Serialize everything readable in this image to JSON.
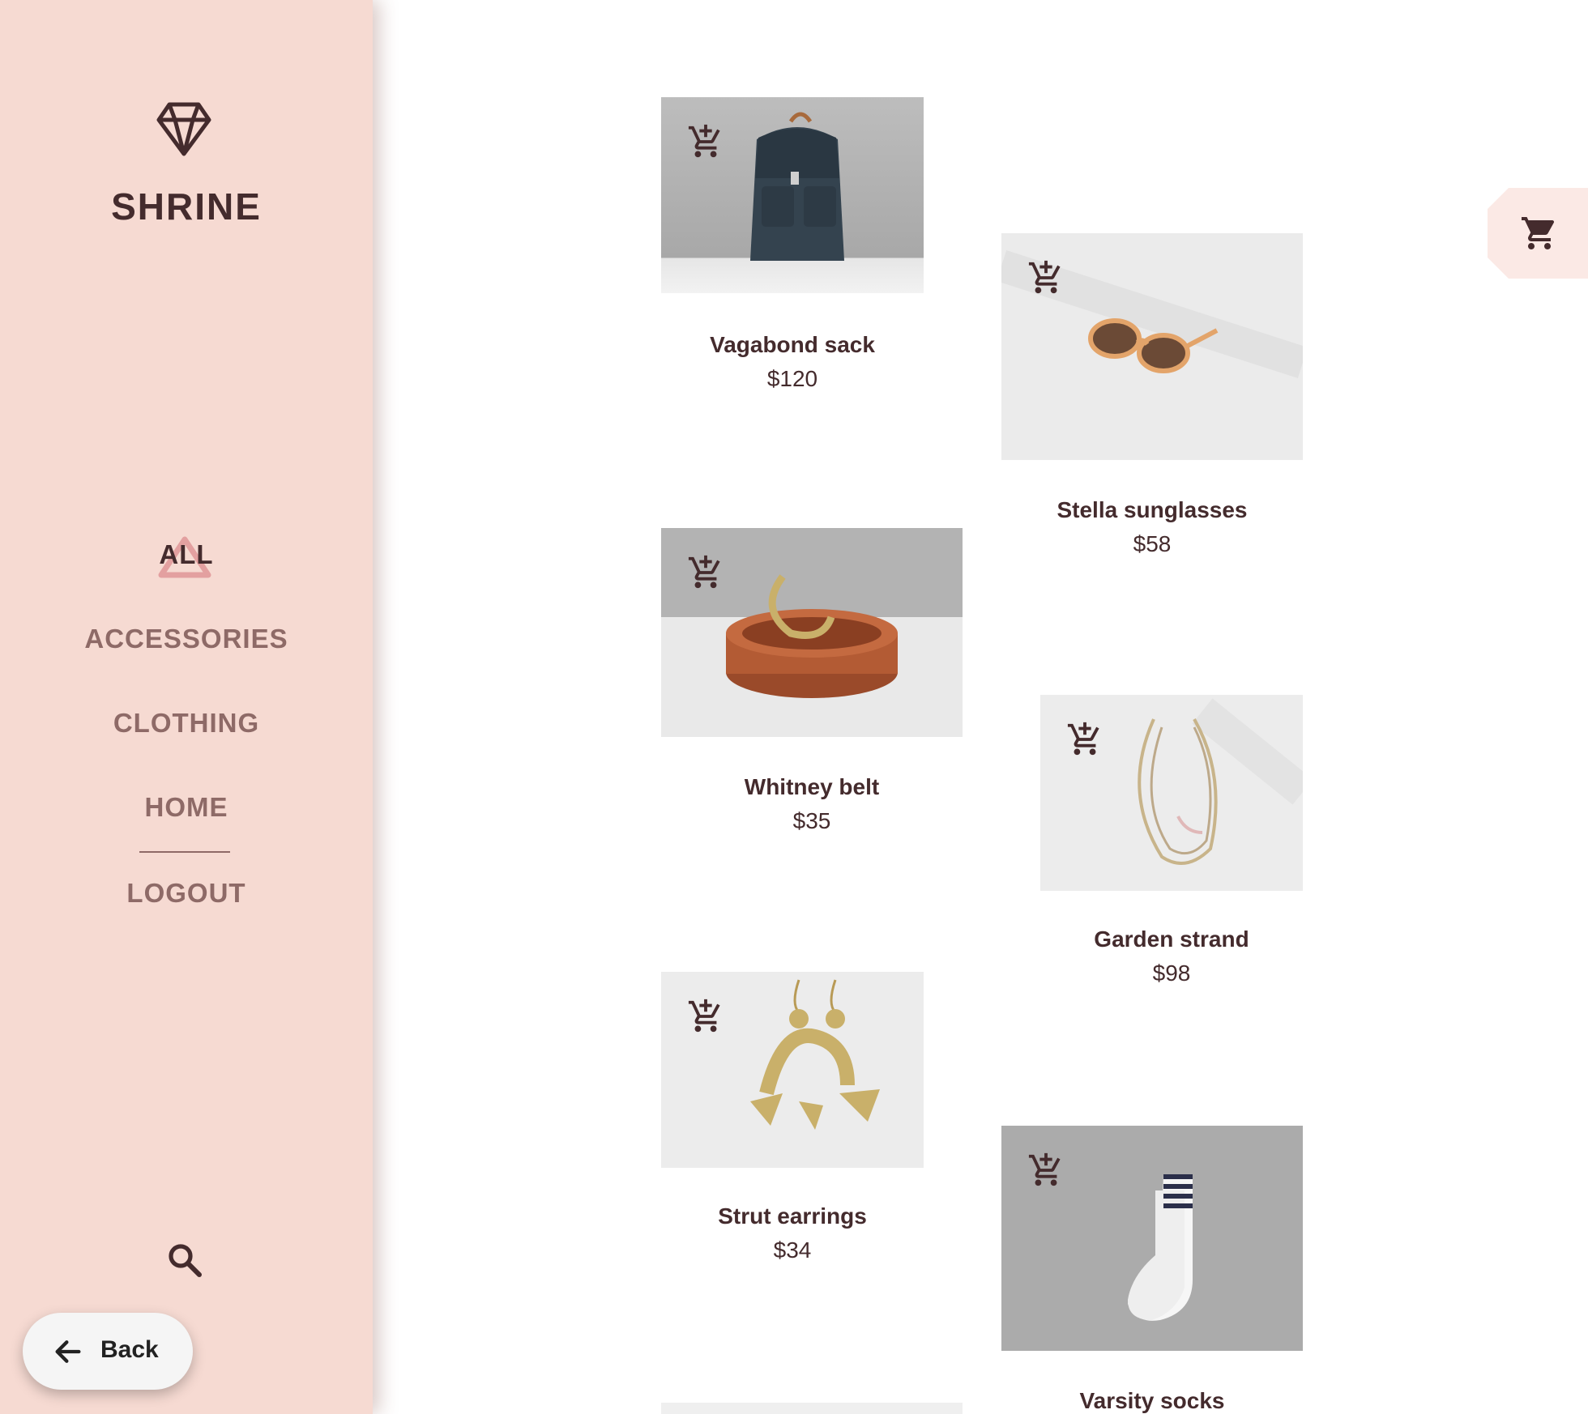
{
  "sidebar": {
    "brand": "SHRINE",
    "nav": [
      {
        "label": "ALL",
        "active": true
      },
      {
        "label": "ACCESSORIES"
      },
      {
        "label": "CLOTHING"
      },
      {
        "label": "HOME"
      },
      {
        "label": "LOGOUT"
      }
    ]
  },
  "back_button": {
    "label": "Back"
  },
  "icons": {
    "logo": "diamond-icon",
    "search": "search-icon",
    "back": "arrow-left-icon",
    "cart": "shopping-cart-icon",
    "add_to_cart": "add-shopping-cart-icon"
  },
  "products": [
    {
      "name": "Vagabond sack",
      "price": "$120"
    },
    {
      "name": "Stella sunglasses",
      "price": "$58"
    },
    {
      "name": "Whitney belt",
      "price": "$35"
    },
    {
      "name": "Garden strand",
      "price": "$98"
    },
    {
      "name": "Strut earrings",
      "price": "$34"
    },
    {
      "name": "Varsity socks",
      "price": ""
    }
  ],
  "colors": {
    "sidebar_bg": "#f6dad2",
    "text": "#442b2d",
    "nav_inactive": "#8e6a67",
    "accent_triangle": "#e3a0a0",
    "cart_fab_bg": "#fbe9e5"
  }
}
